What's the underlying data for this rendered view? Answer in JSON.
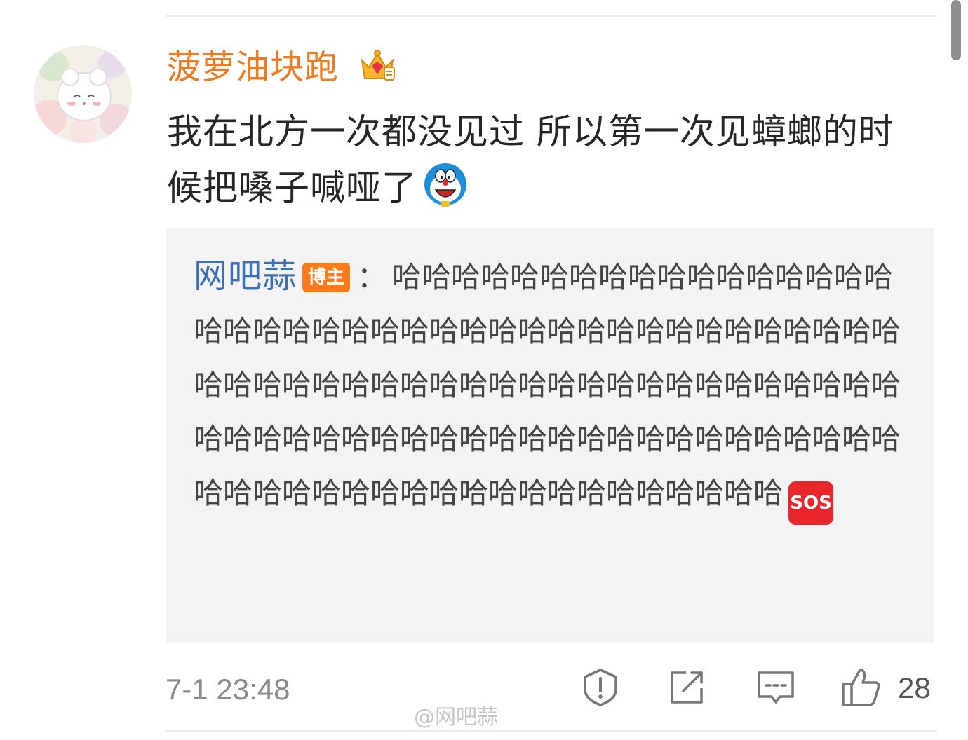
{
  "comment": {
    "username": "菠萝油块跑",
    "text": "我在北方一次都没见过 所以第一次见蟑螂的时候把嗓子喊哑了",
    "timestamp": "7-1 23:48",
    "like_count": "28"
  },
  "reply": {
    "author": "网吧蒜",
    "badge": "博主",
    "separator": "：",
    "text": "哈哈哈哈哈哈哈哈哈哈哈哈哈哈哈哈哈哈哈哈哈哈哈哈哈哈哈哈哈哈哈哈哈哈哈哈哈哈哈哈哈哈哈哈哈哈哈哈哈哈哈哈哈哈哈哈哈哈哈哈哈哈哈哈哈哈哈哈哈哈哈哈哈哈哈哈哈哈哈哈哈哈哈哈哈哈哈哈哈哈哈哈哈哈哈哈哈哈哈哈哈哈哈哈哈哈哈哈哈",
    "sos_label": "SOS"
  },
  "watermark": "@网吧蒜",
  "icons": {
    "crown": "crown-badge-icon",
    "doraemon": "doraemon-emoji-icon",
    "sos": "sos-emoji-icon",
    "report": "report-icon",
    "share": "share-icon",
    "comment": "comment-icon",
    "like": "thumbs-up-icon"
  },
  "colors": {
    "username": "#f07a20",
    "reply_author": "#3b70b6",
    "badge": "#ff7a1a",
    "sos": "#e8262c",
    "reply_background": "#f3f3f3"
  }
}
